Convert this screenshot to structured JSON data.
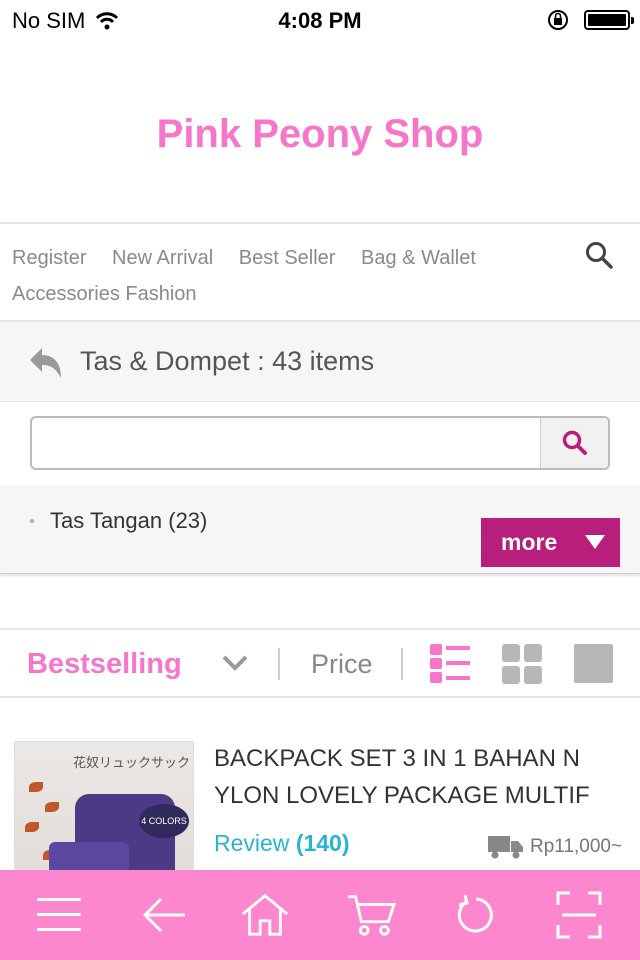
{
  "status_bar": {
    "carrier": "No SIM",
    "time": "4:08 PM"
  },
  "header": {
    "shop_name": "Pink Peony Shop"
  },
  "nav": {
    "items": [
      {
        "label": "Register"
      },
      {
        "label": "New Arrival"
      },
      {
        "label": "Best Seller"
      },
      {
        "label": "Bag & Wallet"
      },
      {
        "label": "Accessories Fashion"
      }
    ]
  },
  "category": {
    "title": "Tas & Dompet : 43 items"
  },
  "search": {
    "value": "",
    "placeholder": ""
  },
  "subcategories": [
    {
      "label": "Tas Tangan (23)"
    }
  ],
  "more_button": {
    "label": "more"
  },
  "sort_bar": {
    "sort_label": "Bestselling",
    "price_label": "Price"
  },
  "product": {
    "title_line1": "BACKPACK SET 3 IN 1 BAHAN N",
    "title_line2": "YLON LOVELY PACKAGE MULTIF",
    "review_label": "Review",
    "review_count": "(140)",
    "price": "Rp11,000~",
    "image_text_jp": "花奴リュックサック",
    "image_badge": "4 COLORS"
  },
  "toolbar": {
    "items": [
      "menu-icon",
      "back-arrow-icon",
      "home-icon",
      "cart-icon",
      "refresh-icon",
      "fullscreen-icon"
    ]
  },
  "colors": {
    "brand_pink": "#f776c9",
    "accent_magenta": "#b81f7c",
    "toolbar_pink": "#fd87cf",
    "review_cyan": "#26b7cf"
  }
}
